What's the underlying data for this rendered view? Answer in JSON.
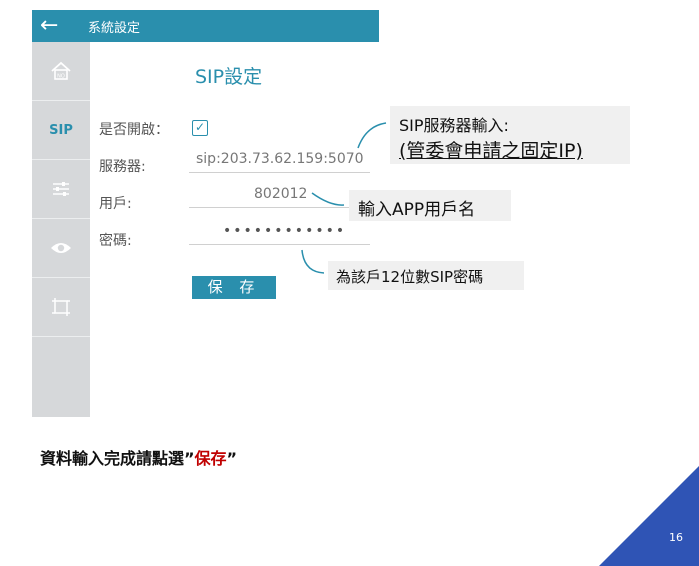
{
  "app": {
    "back_icon": "back-arrow-icon",
    "title": "系統設定"
  },
  "sidebar": {
    "items": [
      {
        "name": "home-icon",
        "label": ""
      },
      {
        "name": "sip",
        "label": "SIP"
      },
      {
        "name": "sliders-icon",
        "label": ""
      },
      {
        "name": "eye-icon",
        "label": ""
      },
      {
        "name": "crop-icon",
        "label": ""
      }
    ]
  },
  "form": {
    "title": "SIP設定",
    "enable_label": "是否開啟：",
    "enable_checked": true,
    "server_label": "服務器:",
    "server_value": "sip:203.73.62.159:5070",
    "user_label": "用戶:",
    "user_value": "802012",
    "password_label": "密碼:",
    "password_value": "••••••••••••",
    "save_label": "保 存"
  },
  "callouts": {
    "server_line1": "SIP服務器輸入:",
    "server_line2": "(管委會申請之固定IP)",
    "user": "輸入APP用戶名",
    "password": "為該戶12位數SIP密碼"
  },
  "instruction": {
    "prefix": "資料輸入完成請點選”",
    "emphasis": "保存",
    "suffix": "”"
  },
  "colors": {
    "accent": "#2a8fad",
    "emphasis": "#c00000",
    "corner": "#2f54b5"
  },
  "page_number": "16"
}
